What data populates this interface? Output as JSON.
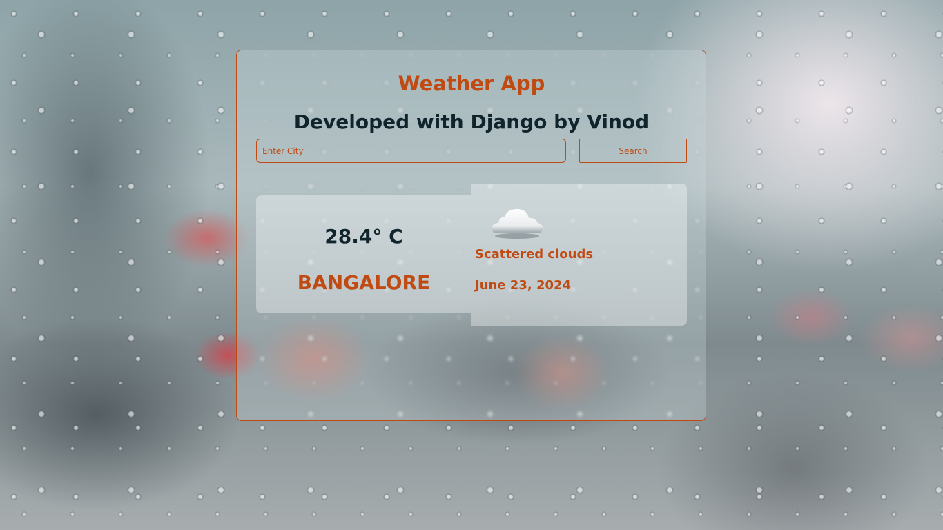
{
  "app": {
    "title": "Weather App",
    "subtitle": "Developed with Django by Vinod"
  },
  "search": {
    "placeholder": "Enter City",
    "value": "",
    "button_label": "Search"
  },
  "weather": {
    "temperature": "28.4° C",
    "city": "BANGALORE",
    "icon": "cloud-icon",
    "description": "Scattered clouds",
    "date": "June 23, 2024"
  },
  "colors": {
    "accent": "#c04a12",
    "heading_dark": "#10252b"
  }
}
